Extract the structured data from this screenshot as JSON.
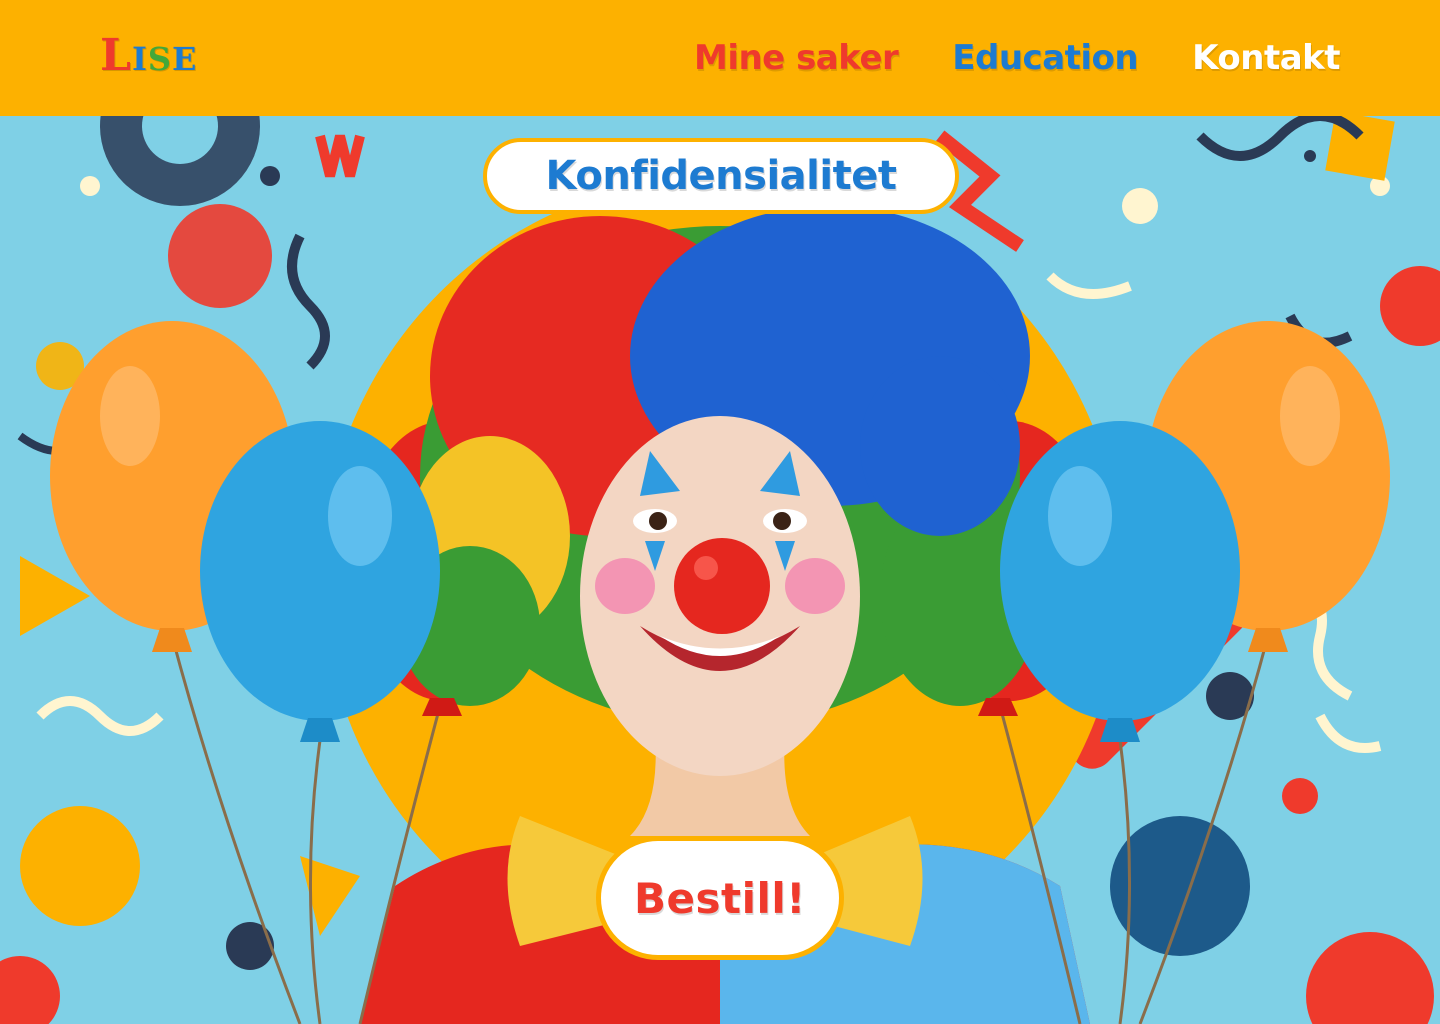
{
  "header": {
    "logo_letters": [
      "L",
      "I",
      "S",
      "E"
    ],
    "nav": [
      {
        "label": "Mine saker",
        "color": "#ef3a2c"
      },
      {
        "label": "Education",
        "color": "#1d7bd1"
      },
      {
        "label": "Kontakt",
        "color": "#ffffff"
      }
    ],
    "background": "#fdb100"
  },
  "hero": {
    "title": "Konfidensialitet",
    "cta_label": "Bestill!",
    "background_color": "#7fd0e6",
    "accent_yellow": "#fdb100",
    "balloon_colors": [
      "#ff9f2e",
      "#2fa4e0",
      "#e5271f"
    ],
    "image": "clown-with-balloons"
  }
}
